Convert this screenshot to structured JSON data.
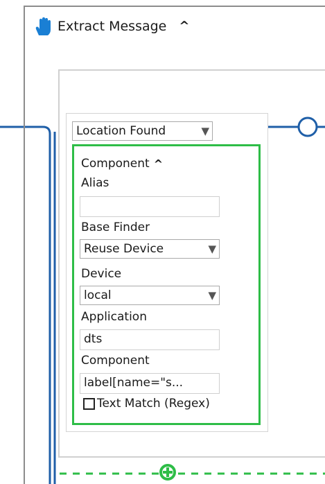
{
  "block": {
    "title": "Extract Message",
    "collapse_icon": "caret-up-icon",
    "icon": "hand-icon",
    "icon_color": "#1a7fd4"
  },
  "location": {
    "selected": "Location Found"
  },
  "component_section": {
    "header": "Component",
    "collapse_icon": "caret-up-icon",
    "border_color": "#2ebd47",
    "alias_label": "Alias",
    "alias_value": "",
    "base_finder_label": "Base Finder",
    "base_finder_selected": "Reuse Device",
    "device_label": "Device",
    "device_selected": "local",
    "application_label": "Application",
    "application_value": "dts",
    "component_label": "Component",
    "component_value": "label[name=\"s...",
    "text_match_label": "Text Match (Regex)",
    "text_match_checked": false
  },
  "connectors": {
    "wire_color": "#1f5fa8",
    "add_button_color": "#2ebd47",
    "add_icon": "plus-circle-icon",
    "output_node_icon": "output-node-icon"
  }
}
